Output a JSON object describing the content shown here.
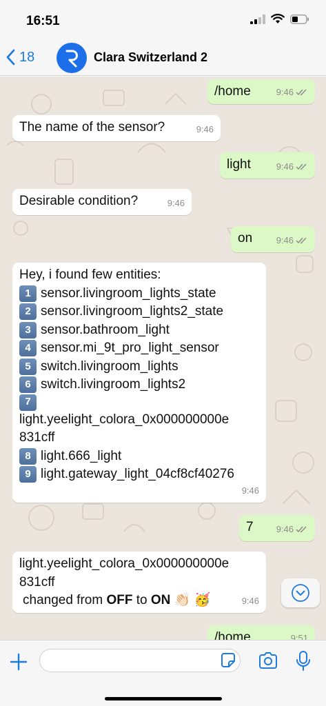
{
  "status": {
    "time": "16:51"
  },
  "header": {
    "back_count": "18",
    "title": "Clara Switzerland 2",
    "avatar_letter": "R"
  },
  "messages": {
    "m1": {
      "text": "/home",
      "time": "9:46"
    },
    "m2": {
      "text": "The name of the sensor?",
      "time": "9:46"
    },
    "m3": {
      "text": "light",
      "time": "9:46"
    },
    "m4": {
      "text": "Desirable condition?",
      "time": "9:46"
    },
    "m5": {
      "text": "on",
      "time": "9:46"
    },
    "m6": {
      "intro": "Hey, i found few entities:",
      "items": [
        {
          "num": "1",
          "text": "sensor.livingroom_lights_state"
        },
        {
          "num": "2",
          "text": "sensor.livingroom_lights2_state"
        },
        {
          "num": "3",
          "text": "sensor.bathroom_light"
        },
        {
          "num": "4",
          "text": "sensor.mi_9t_pro_light_sensor"
        },
        {
          "num": "5",
          "text": "switch.livingroom_lights"
        },
        {
          "num": "6",
          "text": "switch.livingroom_lights2"
        },
        {
          "num": "7",
          "text": "light.yeelight_colora_0x000000000e",
          "text2": "831cff"
        },
        {
          "num": "8",
          "text": "light.666_light"
        },
        {
          "num": "9",
          "text": "light.gateway_light_04cf8cf40276"
        }
      ],
      "time": "9:46"
    },
    "m7": {
      "text": "7",
      "time": "9:46"
    },
    "m8": {
      "line1": "light.yeelight_colora_0x000000000e",
      "line2": "831cff",
      "changed_prefix": "changed from ",
      "from_state": "OFF",
      "to_word": " to ",
      "to_state": "ON",
      "emojis": "👏🏻 🥳",
      "time": "9:46"
    },
    "m9": {
      "text": "/home",
      "time": "9:51"
    }
  },
  "icons": {
    "back": "chevron-left-icon",
    "read": "double-check-icon",
    "scroll": "chevron-down-icon",
    "plus": "plus-icon",
    "sticker": "sticker-icon",
    "camera": "camera-icon",
    "mic": "microphone-icon"
  },
  "colors": {
    "accent": "#1f7ae0",
    "outgoing_bubble": "#dcf8c6",
    "incoming_bubble": "#ffffff",
    "chat_bg": "#ece5dd"
  }
}
